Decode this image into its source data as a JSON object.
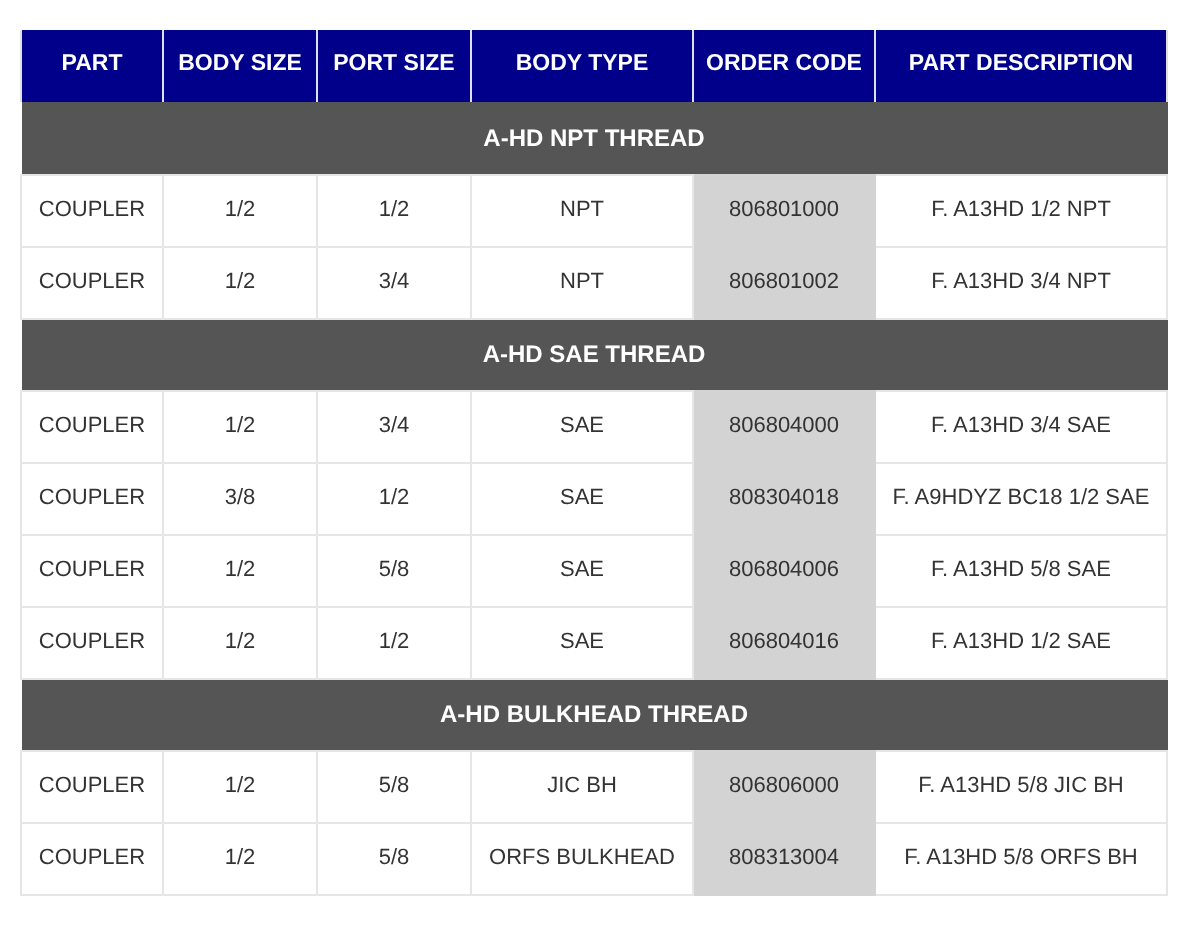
{
  "table": {
    "columns": [
      {
        "label": "PART",
        "highlighted": false
      },
      {
        "label": "BODY SIZE",
        "highlighted": false
      },
      {
        "label": "PORT SIZE",
        "highlighted": false
      },
      {
        "label": "BODY TYPE",
        "highlighted": false
      },
      {
        "label": "ORDER CODE",
        "highlighted": true
      },
      {
        "label": "PART DESCRIPTION",
        "highlighted": false
      }
    ],
    "sections": [
      {
        "title": "A-HD NPT THREAD",
        "rows": [
          [
            "COUPLER",
            "1/2",
            "1/2",
            "NPT",
            "806801000",
            "F. A13HD 1/2 NPT"
          ],
          [
            "COUPLER",
            "1/2",
            "3/4",
            "NPT",
            "806801002",
            "F. A13HD 3/4 NPT"
          ]
        ]
      },
      {
        "title": "A-HD SAE THREAD",
        "rows": [
          [
            "COUPLER",
            "1/2",
            "3/4",
            "SAE",
            "806804000",
            "F. A13HD 3/4 SAE"
          ],
          [
            "COUPLER",
            "3/8",
            "1/2",
            "SAE",
            "808304018",
            "F. A9HDYZ BC18 1/2 SAE"
          ],
          [
            "COUPLER",
            "1/2",
            "5/8",
            "SAE",
            "806804006",
            "F. A13HD 5/8 SAE"
          ],
          [
            "COUPLER",
            "1/2",
            "1/2",
            "SAE",
            "806804016",
            "F. A13HD 1/2 SAE"
          ]
        ]
      },
      {
        "title": "A-HD BULKHEAD THREAD",
        "rows": [
          [
            "COUPLER",
            "1/2",
            "5/8",
            "JIC BH",
            "806806000",
            "F. A13HD 5/8 JIC BH"
          ],
          [
            "COUPLER",
            "1/2",
            "5/8",
            "ORFS BULKHEAD",
            "808313004",
            "F. A13HD 5/8 ORFS BH"
          ]
        ]
      }
    ]
  }
}
